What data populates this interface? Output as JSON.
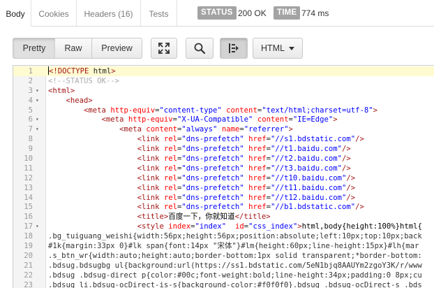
{
  "tabs": [
    {
      "label": "Body"
    },
    {
      "label": "Cookies"
    },
    {
      "label": "Headers (16)"
    },
    {
      "label": "Tests"
    }
  ],
  "status": {
    "label": "STATUS",
    "value": "200 OK"
  },
  "time": {
    "label": "TIME",
    "value": "774 ms"
  },
  "toolbar": {
    "pretty": "Pretty",
    "raw": "Raw",
    "preview": "Preview",
    "expand_icon": "expand-icon",
    "search_icon": "search-icon",
    "wrap_icon": "wrap-lines-icon",
    "format": "HTML"
  },
  "editor": {
    "lines": [
      {
        "n": "1",
        "fold": "",
        "text": "<!DOCTYPE html>"
      },
      {
        "n": "2",
        "fold": "",
        "text": "<!--STATUS OK-->"
      },
      {
        "n": "3",
        "fold": "▾",
        "text": "<html>"
      },
      {
        "n": "4",
        "fold": "▾",
        "text": "    <head>"
      },
      {
        "n": "5",
        "fold": "",
        "text": "        <meta http-equiv=\"content-type\" content=\"text/html;charset=utf-8\">"
      },
      {
        "n": "6",
        "fold": "▾",
        "text": "            <meta http-equiv=\"X-UA-Compatible\" content=\"IE=Edge\">"
      },
      {
        "n": "7",
        "fold": "▾",
        "text": "                <meta content=\"always\" name=\"referrer\">"
      },
      {
        "n": "8",
        "fold": "",
        "text": "                    <link rel=\"dns-prefetch\" href=\"//s1.bdstatic.com\"/>"
      },
      {
        "n": "9",
        "fold": "",
        "text": "                    <link rel=\"dns-prefetch\" href=\"//t1.baidu.com\"/>"
      },
      {
        "n": "10",
        "fold": "",
        "text": "                    <link rel=\"dns-prefetch\" href=\"//t2.baidu.com\"/>"
      },
      {
        "n": "11",
        "fold": "",
        "text": "                    <link rel=\"dns-prefetch\" href=\"//t3.baidu.com\"/>"
      },
      {
        "n": "12",
        "fold": "",
        "text": "                    <link rel=\"dns-prefetch\" href=\"//t10.baidu.com\"/>"
      },
      {
        "n": "13",
        "fold": "",
        "text": "                    <link rel=\"dns-prefetch\" href=\"//t11.baidu.com\"/>"
      },
      {
        "n": "14",
        "fold": "",
        "text": "                    <link rel=\"dns-prefetch\" href=\"//t12.baidu.com\"/>"
      },
      {
        "n": "15",
        "fold": "",
        "text": "                    <link rel=\"dns-prefetch\" href=\"//b1.bdstatic.com\"/>"
      },
      {
        "n": "16",
        "fold": "",
        "text": "                    <title>百度一下，你就知道</title>"
      },
      {
        "n": "17",
        "fold": "▾",
        "text": "                    <style index=\"index\"  id=\"css_index\">html,body{height:100%}html{"
      },
      {
        "n": "18",
        "fold": "",
        "text": ".bg_tuiguang_weishi{width:56px;height:56px;position:absolute;left:10px;top:10px;back"
      },
      {
        "n": "19",
        "fold": "",
        "text": "#1k{margin:33px 0}#lk span{font:14px \"宋体\"}#lm{height:60px;line-height:15px}#lh{mar"
      },
      {
        "n": "20",
        "fold": "",
        "text": ".s_btn_wr{width:auto;height:auto;border-bottom:1px solid transparent;*border-bottom:"
      },
      {
        "n": "21",
        "fold": "",
        "text": ".bdsug.bdsugbg ul{background:url(https://ss1.bdstatic.com/5eN1bjq8AAUYm2zgoY3K/r/www"
      },
      {
        "n": "22",
        "fold": "",
        "text": ".bdsug .bdsug-direct p{color:#00c;font-weight:bold;line-height:34px;padding:0 8px;cu"
      },
      {
        "n": "23",
        "fold": "",
        "text": ".bdsug li.bdsug-ocDirect-is-s{background-color:#f0f0f0}.bdsug .bdsug-ocDirect-s .bds"
      }
    ]
  },
  "colors": {
    "tag": "#a31515",
    "attr": "#ff0000",
    "value": "#0000ff",
    "comment": "#aaaaaa",
    "pill_bg": "#a3a3a3",
    "highlight_line": "#fffbd0"
  }
}
